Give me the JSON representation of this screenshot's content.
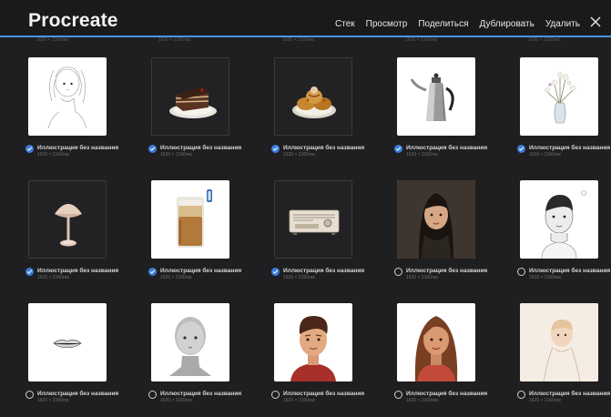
{
  "app": {
    "title": "Procreate"
  },
  "toolbar": {
    "stack": "Стек",
    "preview": "Просмотр",
    "share": "Поделиться",
    "duplicate": "Дублировать",
    "delete": "Удалить"
  },
  "ghost_labels": [
    "1620 × 2160пкс",
    "1620 × 2160пкс",
    "1620 × 2160пкс",
    "1620 × 2160пкс",
    "1620 × 2160пкс"
  ],
  "gallery": {
    "items": [
      {
        "name": "Иллюстрация без названия",
        "size": "1620 × 2160пкс",
        "selected": true,
        "art": "sketch-girl"
      },
      {
        "name": "Иллюстрация без названия",
        "size": "1620 × 2160пкс",
        "selected": true,
        "art": "cake-slice"
      },
      {
        "name": "Иллюстрация без названия",
        "size": "1620 × 2160пкс",
        "selected": true,
        "art": "pastries"
      },
      {
        "name": "Иллюстрация без названия",
        "size": "1620 × 2160пкс",
        "selected": true,
        "art": "teapot"
      },
      {
        "name": "Иллюстрация без названия",
        "size": "1620 × 2160пкс",
        "selected": true,
        "art": "flower-vase"
      },
      {
        "name": "Иллюстрация без названия",
        "size": "1620 × 2160пкс",
        "selected": true,
        "art": "lamp"
      },
      {
        "name": "Иллюстрация без названия",
        "size": "1620 × 2160пкс",
        "selected": true,
        "art": "coffee-glass"
      },
      {
        "name": "Иллюстрация без названия",
        "size": "1620 × 2160пкс",
        "selected": true,
        "art": "radio"
      },
      {
        "name": "Иллюстрация без названия",
        "size": "1620 × 2160пкс",
        "selected": false,
        "art": "woman-dark"
      },
      {
        "name": "Иллюстрация без названия",
        "size": "1620 × 2160пкс",
        "selected": false,
        "art": "man-head"
      },
      {
        "name": "Иллюстрация без названия",
        "size": "1620 × 2160пкс",
        "selected": false,
        "art": "lips"
      },
      {
        "name": "Иллюстрация без названия",
        "size": "1620 × 2160пкс",
        "selected": false,
        "art": "bald-head"
      },
      {
        "name": "Иллюстрация без названия",
        "size": "1620 × 2160пкс",
        "selected": false,
        "art": "man-portrait"
      },
      {
        "name": "Иллюстрация без названия",
        "size": "1620 × 2160пкс",
        "selected": false,
        "art": "woman-portrait"
      },
      {
        "name": "Иллюстрация без названия",
        "size": "1620 × 2160пкс",
        "selected": false,
        "art": "child-sketch"
      }
    ]
  },
  "colors": {
    "accent": "#3b7dd8",
    "background": "#1f1f21"
  },
  "icons": {
    "close": "close-icon",
    "check": "checkmark-icon"
  }
}
